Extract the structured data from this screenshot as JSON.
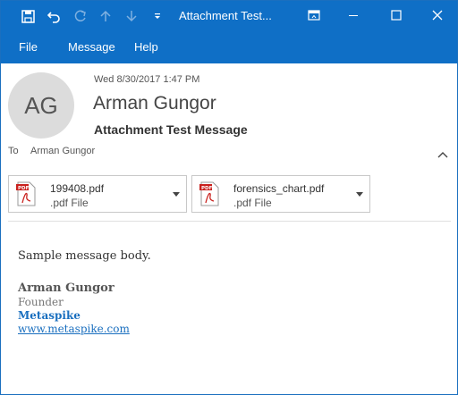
{
  "titlebar": {
    "title": "Attachment Test...",
    "icons": [
      "save-icon",
      "undo-icon",
      "redo-icon",
      "arrow-up-icon",
      "arrow-down-icon",
      "customize-dropdown-icon"
    ],
    "window_controls": [
      "restore-ribbon-icon",
      "minimize-icon",
      "maximize-icon",
      "close-icon"
    ]
  },
  "menu": {
    "items": [
      {
        "label": "File"
      },
      {
        "label": "Message"
      },
      {
        "label": "Help"
      }
    ]
  },
  "message": {
    "avatar_initials": "AG",
    "date": "Wed 8/30/2017 1:47 PM",
    "sender": "Arman Gungor",
    "subject": "Attachment Test Message",
    "to_label": "To",
    "to_value": "Arman Gungor"
  },
  "attachments": [
    {
      "name": "199408.pdf",
      "type": ".pdf File",
      "icon": "pdf-file-icon"
    },
    {
      "name": "forensics_chart.pdf",
      "type": ".pdf File",
      "icon": "pdf-file-icon"
    }
  ],
  "body": {
    "text": "Sample message body.",
    "signature": {
      "name": "Arman Gungor",
      "title": "Founder",
      "company": "Metaspike",
      "website": "www.metaspike.com"
    }
  },
  "colors": {
    "accent": "#0f6fc6",
    "link": "#1a6fbf",
    "pdf_red": "#c9211e"
  }
}
